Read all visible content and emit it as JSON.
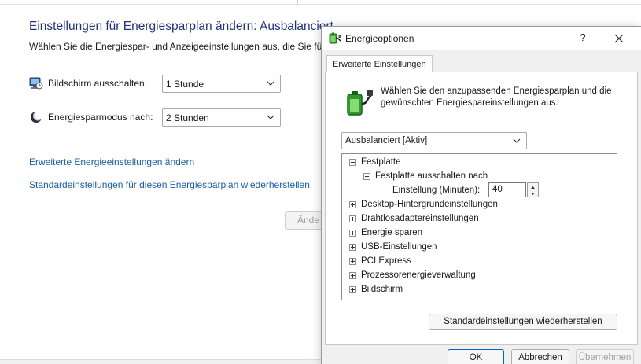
{
  "background": {
    "title": "Einstellungen für Energiesparplan ändern: Ausbalanciert",
    "subtitle": "Wählen Sie die Energiespar- und Anzeigeeinstellungen aus, die Sie für d",
    "display_off": {
      "label": "Bildschirm ausschalten:",
      "value": "1 Stunde"
    },
    "sleep": {
      "label": "Energiesparmodus nach:",
      "value": "2 Stunden"
    },
    "links": {
      "advanced": "Erweiterte Energieeinstellungen ändern",
      "restore": "Standardeinstellungen für diesen Energiesparplan wiederherstellen"
    },
    "save_button": "Ände"
  },
  "dialog": {
    "title": "Energieoptionen",
    "help_label": "?",
    "tab": "Erweiterte Einstellungen",
    "intro": "Wählen Sie den anzupassenden Energiesparplan und die gewünschten Energiespareinstellungen aus.",
    "plan_selected": "Ausbalanciert [Aktiv]",
    "tree": {
      "festplatte": "Festplatte",
      "festplatte_aus": "Festplatte ausschalten nach",
      "einstellung_label": "Einstellung (Minuten):",
      "einstellung_value": "40",
      "items": [
        "Desktop-Hintergrundeinstellungen",
        "Drahtlosadaptereinstellungen",
        "Energie sparen",
        "USB-Einstellungen",
        "PCI Express",
        "Prozessorenergieverwaltung",
        "Bildschirm"
      ]
    },
    "restore_button": "Standardeinstellungen wiederherstellen",
    "buttons": {
      "ok": "OK",
      "cancel": "Abbrechen",
      "apply": "Übernehmen"
    }
  },
  "colors": {
    "title_blue": "#1e3287",
    "link_blue": "#1a5fb4",
    "accent": "#0067c0",
    "dialog_bg": "#f0f0f0"
  }
}
